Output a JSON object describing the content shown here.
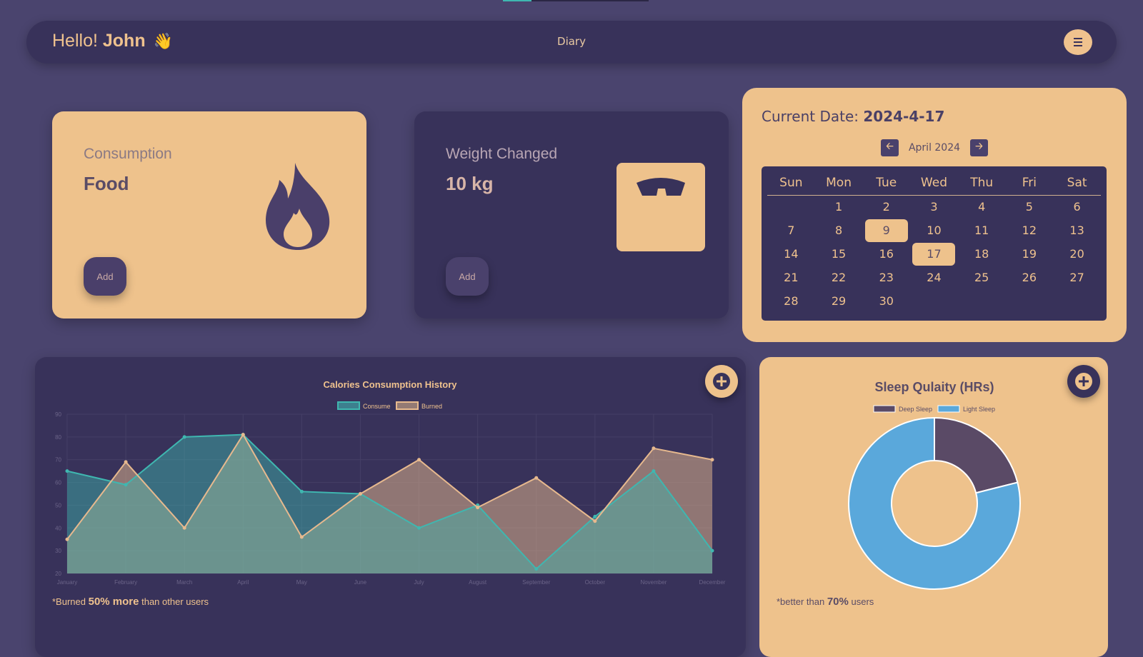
{
  "header": {
    "greeting_prefix": "Hello!",
    "user_name": "John",
    "wave_emoji": "👋",
    "nav_title": "Diary",
    "menu_icon": "hamburger-menu-icon"
  },
  "cards": {
    "food": {
      "label": "Consumption",
      "value": "Food",
      "add_label": "Add",
      "icon": "flame-icon"
    },
    "weight": {
      "label": "Weight Changed",
      "value": "10 kg",
      "add_label": "Add",
      "icon": "scale-icon"
    }
  },
  "calendar": {
    "title_prefix": "Current Date:",
    "current_date": "2024-4-17",
    "month_label": "April 2024",
    "prev_icon": "arrow-left-icon",
    "next_icon": "arrow-right-icon",
    "weekdays": [
      "Sun",
      "Mon",
      "Tue",
      "Wed",
      "Thu",
      "Fri",
      "Sat"
    ],
    "weeks": [
      [
        "",
        "1",
        "2",
        "3",
        "4",
        "5",
        "6"
      ],
      [
        "7",
        "8",
        "9",
        "10",
        "11",
        "12",
        "13"
      ],
      [
        "14",
        "15",
        "16",
        "17",
        "18",
        "19",
        "20"
      ],
      [
        "21",
        "22",
        "23",
        "24",
        "25",
        "26",
        "27"
      ],
      [
        "28",
        "29",
        "30",
        "",
        "",
        "",
        ""
      ]
    ],
    "highlighted_days": [
      "9",
      "17"
    ]
  },
  "calories_chart": {
    "add_icon": "plus-circle-icon",
    "footnote_prefix": "*Burned",
    "footnote_bold": "50% more",
    "footnote_suffix": "than other users"
  },
  "sleep_chart": {
    "add_icon": "plus-circle-icon",
    "footnote_prefix": "*better than",
    "footnote_bold": "70%",
    "footnote_suffix": "users"
  },
  "colors": {
    "background": "#4a446e",
    "panel_dark": "#38325a",
    "panel_light": "#eec28c",
    "consume": "#3fb7b0",
    "burned": "#e7b98e",
    "deep_sleep": "#5a4a66",
    "light_sleep": "#5aa8db"
  },
  "chart_data": [
    {
      "type": "area",
      "title": "Calories Consumption History",
      "categories": [
        "January",
        "February",
        "March",
        "April",
        "May",
        "June",
        "July",
        "August",
        "September",
        "October",
        "November",
        "December"
      ],
      "ylim": [
        20,
        90
      ],
      "yticks": [
        20,
        30,
        40,
        50,
        60,
        70,
        80,
        90
      ],
      "grid": true,
      "legend": "top",
      "series": [
        {
          "name": "Consume",
          "values": [
            65,
            59,
            80,
            81,
            56,
            55,
            40,
            50,
            22,
            45,
            65,
            30
          ]
        },
        {
          "name": "Burned",
          "values": [
            35,
            69,
            40,
            81,
            36,
            55,
            70,
            49,
            62,
            43,
            75,
            70
          ]
        }
      ]
    },
    {
      "type": "pie",
      "title": "Sleep Qulaity (HRs)",
      "legend": "top",
      "categories": [
        "Deep Sleep",
        "Light Sleep"
      ],
      "values": [
        2,
        7.5
      ]
    }
  ]
}
